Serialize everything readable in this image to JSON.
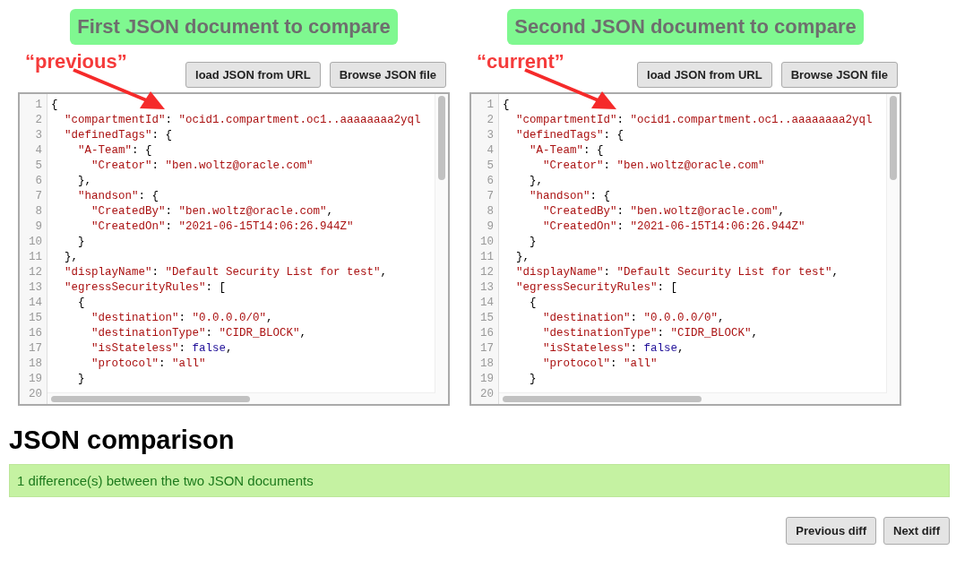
{
  "panels": [
    {
      "title": "First JSON document to compare",
      "annotation": "“previous”",
      "buttons": [
        "load JSON from URL",
        "Browse JSON file"
      ],
      "editor": {
        "lines": [
          {
            "number": "1",
            "tokens": [
              {
                "kind": "punct",
                "text": "{"
              }
            ]
          },
          {
            "number": "2",
            "tokens": [
              {
                "kind": "key",
                "text": "  \"compartmentId\""
              },
              {
                "kind": "punct",
                "text": ": "
              },
              {
                "kind": "string",
                "text": "\"ocid1.compartment.oc1..aaaaaaaa2yql"
              }
            ]
          },
          {
            "number": "3",
            "tokens": [
              {
                "kind": "key",
                "text": "  \"definedTags\""
              },
              {
                "kind": "punct",
                "text": ": {"
              }
            ]
          },
          {
            "number": "4",
            "tokens": [
              {
                "kind": "key",
                "text": "    \"A-Team\""
              },
              {
                "kind": "punct",
                "text": ": {"
              }
            ]
          },
          {
            "number": "5",
            "tokens": [
              {
                "kind": "key",
                "text": "      \"Creator\""
              },
              {
                "kind": "punct",
                "text": ": "
              },
              {
                "kind": "string",
                "text": "\"ben.woltz@oracle.com\""
              }
            ]
          },
          {
            "number": "6",
            "tokens": [
              {
                "kind": "punct",
                "text": "    },"
              }
            ]
          },
          {
            "number": "7",
            "tokens": [
              {
                "kind": "key",
                "text": "    \"handson\""
              },
              {
                "kind": "punct",
                "text": ": {"
              }
            ]
          },
          {
            "number": "8",
            "tokens": [
              {
                "kind": "key",
                "text": "      \"CreatedBy\""
              },
              {
                "kind": "punct",
                "text": ": "
              },
              {
                "kind": "string",
                "text": "\"ben.woltz@oracle.com\""
              },
              {
                "kind": "punct",
                "text": ","
              }
            ]
          },
          {
            "number": "9",
            "tokens": [
              {
                "kind": "key",
                "text": "      \"CreatedOn\""
              },
              {
                "kind": "punct",
                "text": ": "
              },
              {
                "kind": "string",
                "text": "\"2021-06-15T14:06:26.944Z\""
              }
            ]
          },
          {
            "number": "10",
            "tokens": [
              {
                "kind": "punct",
                "text": "    }"
              }
            ]
          },
          {
            "number": "11",
            "tokens": [
              {
                "kind": "punct",
                "text": "  },"
              }
            ]
          },
          {
            "number": "12",
            "tokens": [
              {
                "kind": "key",
                "text": "  \"displayName\""
              },
              {
                "kind": "punct",
                "text": ": "
              },
              {
                "kind": "string",
                "text": "\"Default Security List for test\""
              },
              {
                "kind": "punct",
                "text": ","
              }
            ]
          },
          {
            "number": "13",
            "tokens": [
              {
                "kind": "key",
                "text": "  \"egressSecurityRules\""
              },
              {
                "kind": "punct",
                "text": ": ["
              }
            ]
          },
          {
            "number": "14",
            "tokens": [
              {
                "kind": "punct",
                "text": "    {"
              }
            ]
          },
          {
            "number": "15",
            "tokens": [
              {
                "kind": "key",
                "text": "      \"destination\""
              },
              {
                "kind": "punct",
                "text": ": "
              },
              {
                "kind": "string",
                "text": "\"0.0.0.0/0\""
              },
              {
                "kind": "punct",
                "text": ","
              }
            ]
          },
          {
            "number": "16",
            "tokens": [
              {
                "kind": "key",
                "text": "      \"destinationType\""
              },
              {
                "kind": "punct",
                "text": ": "
              },
              {
                "kind": "string",
                "text": "\"CIDR_BLOCK\""
              },
              {
                "kind": "punct",
                "text": ","
              }
            ]
          },
          {
            "number": "17",
            "tokens": [
              {
                "kind": "key",
                "text": "      \"isStateless\""
              },
              {
                "kind": "punct",
                "text": ": "
              },
              {
                "kind": "literal",
                "text": "false"
              },
              {
                "kind": "punct",
                "text": ","
              }
            ]
          },
          {
            "number": "18",
            "tokens": [
              {
                "kind": "key",
                "text": "      \"protocol\""
              },
              {
                "kind": "punct",
                "text": ": "
              },
              {
                "kind": "string",
                "text": "\"all\""
              }
            ]
          },
          {
            "number": "19",
            "tokens": [
              {
                "kind": "punct",
                "text": "    }"
              }
            ]
          },
          {
            "number": "20"
          }
        ]
      }
    },
    {
      "title": "Second JSON document to compare",
      "annotation": "“current”",
      "buttons": [
        "load JSON from URL",
        "Browse JSON file"
      ],
      "editor": {
        "lines": [
          {
            "number": "1",
            "tokens": [
              {
                "kind": "punct",
                "text": "{"
              }
            ]
          },
          {
            "number": "2",
            "tokens": [
              {
                "kind": "key",
                "text": "  \"compartmentId\""
              },
              {
                "kind": "punct",
                "text": ": "
              },
              {
                "kind": "string",
                "text": "\"ocid1.compartment.oc1..aaaaaaaa2yql"
              }
            ]
          },
          {
            "number": "3",
            "tokens": [
              {
                "kind": "key",
                "text": "  \"definedTags\""
              },
              {
                "kind": "punct",
                "text": ": {"
              }
            ]
          },
          {
            "number": "4",
            "tokens": [
              {
                "kind": "key",
                "text": "    \"A-Team\""
              },
              {
                "kind": "punct",
                "text": ": {"
              }
            ]
          },
          {
            "number": "5",
            "tokens": [
              {
                "kind": "key",
                "text": "      \"Creator\""
              },
              {
                "kind": "punct",
                "text": ": "
              },
              {
                "kind": "string",
                "text": "\"ben.woltz@oracle.com\""
              }
            ]
          },
          {
            "number": "6",
            "tokens": [
              {
                "kind": "punct",
                "text": "    },"
              }
            ]
          },
          {
            "number": "7",
            "tokens": [
              {
                "kind": "key",
                "text": "    \"handson\""
              },
              {
                "kind": "punct",
                "text": ": {"
              }
            ]
          },
          {
            "number": "8",
            "tokens": [
              {
                "kind": "key",
                "text": "      \"CreatedBy\""
              },
              {
                "kind": "punct",
                "text": ": "
              },
              {
                "kind": "string",
                "text": "\"ben.woltz@oracle.com\""
              },
              {
                "kind": "punct",
                "text": ","
              }
            ]
          },
          {
            "number": "9",
            "tokens": [
              {
                "kind": "key",
                "text": "      \"CreatedOn\""
              },
              {
                "kind": "punct",
                "text": ": "
              },
              {
                "kind": "string",
                "text": "\"2021-06-15T14:06:26.944Z\""
              }
            ]
          },
          {
            "number": "10",
            "tokens": [
              {
                "kind": "punct",
                "text": "    }"
              }
            ]
          },
          {
            "number": "11",
            "tokens": [
              {
                "kind": "punct",
                "text": "  },"
              }
            ]
          },
          {
            "number": "12",
            "tokens": [
              {
                "kind": "key",
                "text": "  \"displayName\""
              },
              {
                "kind": "punct",
                "text": ": "
              },
              {
                "kind": "string",
                "text": "\"Default Security List for test\""
              },
              {
                "kind": "punct",
                "text": ","
              }
            ]
          },
          {
            "number": "13",
            "tokens": [
              {
                "kind": "key",
                "text": "  \"egressSecurityRules\""
              },
              {
                "kind": "punct",
                "text": ": ["
              }
            ]
          },
          {
            "number": "14",
            "tokens": [
              {
                "kind": "punct",
                "text": "    {"
              }
            ]
          },
          {
            "number": "15",
            "tokens": [
              {
                "kind": "key",
                "text": "      \"destination\""
              },
              {
                "kind": "punct",
                "text": ": "
              },
              {
                "kind": "string",
                "text": "\"0.0.0.0/0\""
              },
              {
                "kind": "punct",
                "text": ","
              }
            ]
          },
          {
            "number": "16",
            "tokens": [
              {
                "kind": "key",
                "text": "      \"destinationType\""
              },
              {
                "kind": "punct",
                "text": ": "
              },
              {
                "kind": "string",
                "text": "\"CIDR_BLOCK\""
              },
              {
                "kind": "punct",
                "text": ","
              }
            ]
          },
          {
            "number": "17",
            "tokens": [
              {
                "kind": "key",
                "text": "      \"isStateless\""
              },
              {
                "kind": "punct",
                "text": ": "
              },
              {
                "kind": "literal",
                "text": "false"
              },
              {
                "kind": "punct",
                "text": ","
              }
            ]
          },
          {
            "number": "18",
            "tokens": [
              {
                "kind": "key",
                "text": "      \"protocol\""
              },
              {
                "kind": "punct",
                "text": ": "
              },
              {
                "kind": "string",
                "text": "\"all\""
              }
            ]
          },
          {
            "number": "19",
            "tokens": [
              {
                "kind": "punct",
                "text": "    }"
              }
            ]
          },
          {
            "number": "20"
          }
        ]
      }
    }
  ],
  "comparison": {
    "heading": "JSON comparison",
    "result": "1 difference(s) between the two JSON documents",
    "buttons": [
      "Previous diff",
      "Next diff"
    ]
  }
}
